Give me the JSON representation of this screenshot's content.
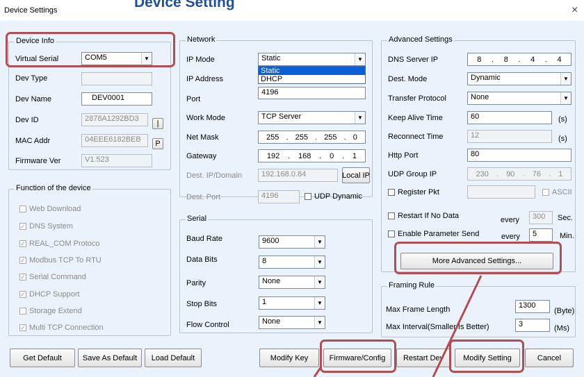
{
  "window": {
    "title": "Device Settings",
    "heading": "Device Setting",
    "close": "×"
  },
  "device_info": {
    "group": "Device Info",
    "virtual_serial_label": "Virtual Serial",
    "virtual_serial_value": "COM5",
    "dev_type_label": "Dev Type",
    "dev_type_value": "",
    "dev_name_label": "Dev Name",
    "dev_name_value": "DEV0001",
    "dev_id_label": "Dev ID",
    "dev_id_value": "2878A1292BD3",
    "dev_id_btn": "|",
    "mac_label": "MAC Addr",
    "mac_value": "04EEE6182BEB",
    "mac_btn": "P",
    "firmware_label": "Firmware Ver",
    "firmware_value": "V1.523"
  },
  "functions": {
    "group": "Function of the device",
    "items": [
      {
        "label": "Web Download",
        "checked": false
      },
      {
        "label": "DNS System",
        "checked": true
      },
      {
        "label": "REAL_COM Protoco",
        "checked": true
      },
      {
        "label": "Modbus TCP To RTU",
        "checked": true
      },
      {
        "label": "Serial Command",
        "checked": true
      },
      {
        "label": "DHCP Support",
        "checked": true
      },
      {
        "label": "Storage Extend",
        "checked": false
      },
      {
        "label": "Multi TCP Connection",
        "checked": true
      }
    ]
  },
  "network": {
    "group": "Network",
    "ip_mode_label": "IP Mode",
    "ip_mode_value": "Static",
    "ip_mode_options": [
      "Static",
      "DHCP"
    ],
    "ip_address_label": "IP Address",
    "port_label": "Port",
    "port_value": "4196",
    "work_mode_label": "Work Mode",
    "work_mode_value": "TCP Server",
    "netmask_label": "Net Mask",
    "netmask": [
      "255",
      "255",
      "255",
      "0"
    ],
    "gateway_label": "Gateway",
    "gateway": [
      "192",
      "168",
      "0",
      "1"
    ],
    "dest_ip_label": "Dest. IP/Domain",
    "dest_ip_value": "192.168.0.84",
    "local_ip_btn": "Local IP",
    "dest_port_label": "Dest. Port",
    "dest_port_value": "4196",
    "udp_dynamic_label": "UDP Dynamic"
  },
  "serial": {
    "group": "Serial",
    "baud_label": "Baud Rate",
    "baud_value": "9600",
    "data_bits_label": "Data Bits",
    "data_bits_value": "8",
    "parity_label": "Parity",
    "parity_value": "None",
    "stop_bits_label": "Stop Bits",
    "stop_bits_value": "1",
    "flow_label": "Flow Control",
    "flow_value": "None"
  },
  "advanced": {
    "group": "Advanced Settings",
    "dns_label": "DNS Server IP",
    "dns": [
      "8",
      "8",
      "4",
      "4"
    ],
    "dest_mode_label": "Dest. Mode",
    "dest_mode_value": "Dynamic",
    "transfer_label": "Transfer Protocol",
    "transfer_value": "None",
    "keepalive_label": "Keep Alive Time",
    "keepalive_value": "60",
    "keepalive_unit": "(s)",
    "reconnect_label": "Reconnect Time",
    "reconnect_value": "12",
    "reconnect_unit": "(s)",
    "http_label": "Http Port",
    "http_value": "80",
    "udp_group_label": "UDP Group IP",
    "udp_group": [
      "230",
      "90",
      "76",
      "1"
    ],
    "register_label": "Register Pkt",
    "ascii_label": "ASCII",
    "restart_label": "Restart If No Data",
    "restart_every": "every",
    "restart_value": "300",
    "restart_unit": "Sec.",
    "enable_param_label": "Enable Parameter Send",
    "param_every": "every",
    "param_value": "5",
    "param_unit": "Min.",
    "more_btn": "More Advanced Settings..."
  },
  "framing": {
    "group": "Framing Rule",
    "max_frame_label": "Max Frame Length",
    "max_frame_value": "1300",
    "max_frame_unit": "(Byte)",
    "max_interval_label": "Max Interval(Smaller Is Better)",
    "max_interval_value": "3",
    "max_interval_unit": "(Ms)"
  },
  "buttons": {
    "get_default": "Get Default",
    "save_default": "Save As Default",
    "load_default": "Load Default",
    "modify_key": "Modify Key",
    "firmware_config": "Firmware/Config",
    "restart_dev": "Restart Dev",
    "modify_setting": "Modify Setting",
    "cancel": "Cancel"
  },
  "colors": {
    "highlight": "#b24d52",
    "heading": "#1f4e9a",
    "selection": "#0a5fd6"
  }
}
